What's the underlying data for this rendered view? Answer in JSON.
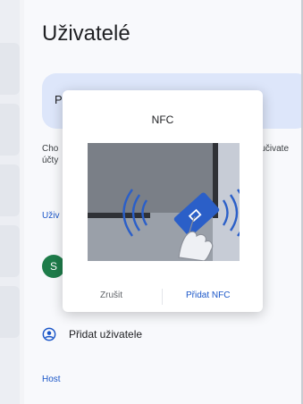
{
  "page": {
    "title": "Uživatelé",
    "profile_card_label": "P",
    "description_left": "Cho\núčty",
    "description_right": "é učivate",
    "section_users": "Uživ",
    "avatar_initial": "S",
    "add_user_label": "Přidat uživatele",
    "section_host": "Host"
  },
  "dialog": {
    "title": "NFC",
    "cancel_label": "Zrušit",
    "add_label": "Přidat NFC"
  },
  "icons": {
    "add_user": "account-circle-icon",
    "illustration": "nfc-tap-illustration"
  },
  "colors": {
    "accent": "#1a56c8",
    "profile_card": "#dde6fa",
    "avatar": "#1e7c4a",
    "nfc_card": "#2b5fc8"
  }
}
